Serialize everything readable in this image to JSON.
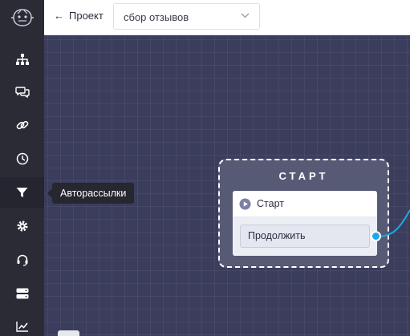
{
  "header": {
    "back_label": "Проект",
    "project_value": "сбор отзывов"
  },
  "sidebar": {
    "items": [
      {
        "icon": "sitemap-icon"
      },
      {
        "icon": "chat-bubbles-icon"
      },
      {
        "icon": "link-icon"
      },
      {
        "icon": "clock-icon"
      },
      {
        "icon": "filter-icon",
        "active": true
      },
      {
        "icon": "gear-icon"
      },
      {
        "icon": "headset-icon"
      },
      {
        "icon": "server-icon"
      },
      {
        "icon": "chart-line-icon"
      }
    ]
  },
  "tooltip": {
    "text": "Авторассылки"
  },
  "flow": {
    "start_block_title": "СТАРТ",
    "node_label": "Старт",
    "continue_label": "Продолжить"
  },
  "colors": {
    "canvas": "#3b3d5c",
    "sidebar": "#2a2b35",
    "port": "#1ea8e8"
  }
}
